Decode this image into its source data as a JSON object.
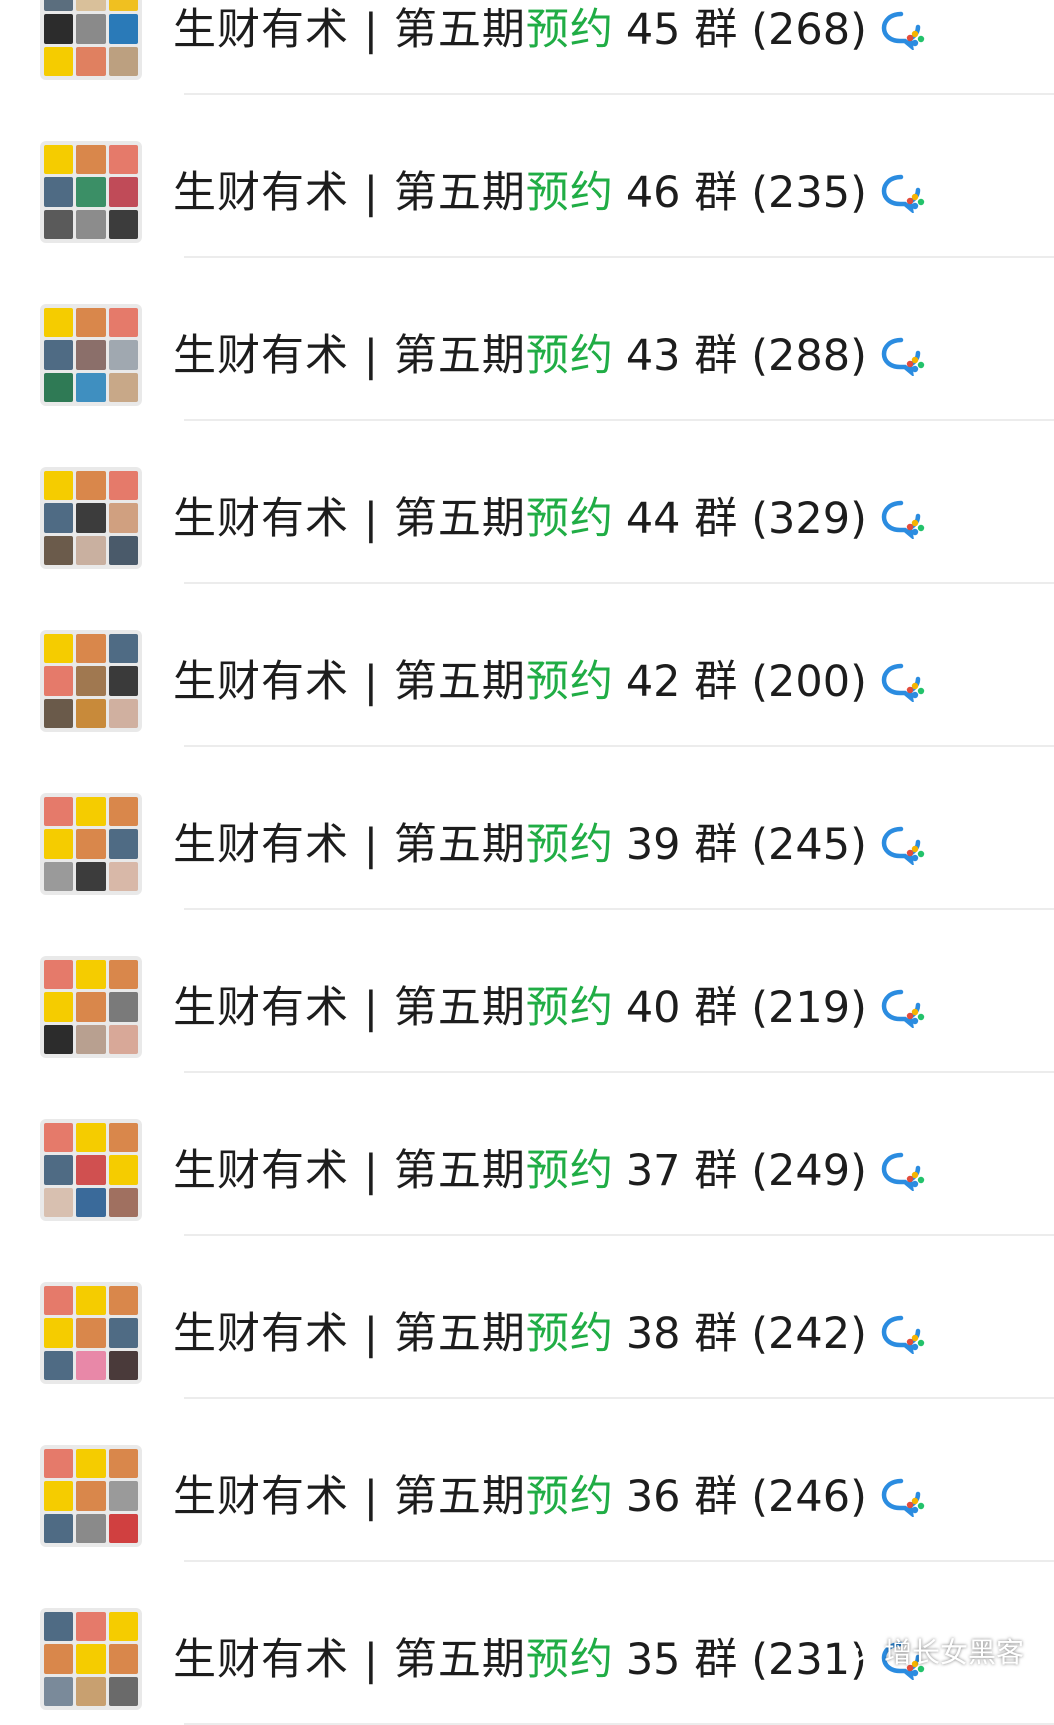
{
  "list": {
    "rows": [
      {
        "prefix": "生财有术 | 第五期",
        "highlight": "预约",
        "number": "45 群",
        "count": "(268)",
        "avatar": [
          "#5b6e7e",
          "#d9c09a",
          "#f0c020",
          "#2c2c2c",
          "#8a8a8a",
          "#2a7ab8",
          "#f5cc00",
          "#e08060",
          "#bca080"
        ]
      },
      {
        "prefix": "生财有术 | 第五期",
        "highlight": "预约",
        "number": "46 群",
        "count": "(235)",
        "avatar": [
          "#f5cc00",
          "#d9874b",
          "#e57a6a",
          "#4f6b84",
          "#3b8f66",
          "#c04b58",
          "#5a5a5a",
          "#8c8c8c",
          "#3c3c3c"
        ]
      },
      {
        "prefix": "生财有术 | 第五期",
        "highlight": "预约",
        "number": "43 群",
        "count": "(288)",
        "avatar": [
          "#f5cc00",
          "#d9874b",
          "#e57a6a",
          "#4f6b84",
          "#8b6f6a",
          "#a0a8b0",
          "#2f7a55",
          "#3f8fc0",
          "#c8a888"
        ]
      },
      {
        "prefix": "生财有术 | 第五期",
        "highlight": "预约",
        "number": "44 群",
        "count": "(329)",
        "avatar": [
          "#f5cc00",
          "#d9874b",
          "#e57a6a",
          "#4f6b84",
          "#3c3c3c",
          "#d0a080",
          "#6b5b4b",
          "#c9b0a0",
          "#4a5a6a"
        ]
      },
      {
        "prefix": "生财有术 | 第五期",
        "highlight": "预约",
        "number": "42 群",
        "count": "(200)",
        "avatar": [
          "#f5cc00",
          "#d9874b",
          "#4f6b84",
          "#e57a6a",
          "#a07850",
          "#3a3a3a",
          "#6a5a4a",
          "#c88a3a",
          "#d0b0a0"
        ]
      },
      {
        "prefix": "生财有术 | 第五期",
        "highlight": "预约",
        "number": "39 群",
        "count": "(245)",
        "avatar": [
          "#e57a6a",
          "#f5cc00",
          "#d9874b",
          "#f5cc00",
          "#d9874b",
          "#4f6b84",
          "#9a9a9a",
          "#3c3c3c",
          "#d8b8a8"
        ]
      },
      {
        "prefix": "生财有术 | 第五期",
        "highlight": "预约",
        "number": "40 群",
        "count": "(219)",
        "avatar": [
          "#e57a6a",
          "#f5cc00",
          "#d9874b",
          "#f5cc00",
          "#d9874b",
          "#7a7a7a",
          "#2c2c2c",
          "#b8a090",
          "#d8a898"
        ]
      },
      {
        "prefix": "生财有术 | 第五期",
        "highlight": "预约",
        "number": "37 群",
        "count": "(249)",
        "avatar": [
          "#e57a6a",
          "#f5cc00",
          "#d9874b",
          "#4f6b84",
          "#d05050",
          "#f5cc00",
          "#d8c0b0",
          "#3a6a9a",
          "#a07060"
        ]
      },
      {
        "prefix": "生财有术 | 第五期",
        "highlight": "预约",
        "number": "38 群",
        "count": "(242)",
        "avatar": [
          "#e57a6a",
          "#f5cc00",
          "#d9874b",
          "#f5cc00",
          "#d9874b",
          "#4f6b84",
          "#4f6b84",
          "#e888a8",
          "#4a3a3a"
        ]
      },
      {
        "prefix": "生财有术 | 第五期",
        "highlight": "预约",
        "number": "36 群",
        "count": "(246)",
        "avatar": [
          "#e57a6a",
          "#f5cc00",
          "#d9874b",
          "#f5cc00",
          "#d9874b",
          "#9a9a9a",
          "#4f6b84",
          "#8a8a8a",
          "#d04040"
        ]
      },
      {
        "prefix": "生财有术 | 第五期",
        "highlight": "预约",
        "number": "35 群",
        "count": "(231)",
        "avatar": [
          "#4f6b84",
          "#e57a6a",
          "#f5cc00",
          "#d9874b",
          "#f5cc00",
          "#d9874b",
          "#7a8a9a",
          "#c8a070",
          "#6a6a6a"
        ]
      }
    ]
  },
  "watermark": {
    "text": "增长女黑客",
    "icon": "wechat-channel-icon"
  },
  "colors": {
    "highlight": "#20ad45",
    "text": "#1d1d1d",
    "divider": "#ececec",
    "wecom_blue": "#2b8ce0"
  }
}
